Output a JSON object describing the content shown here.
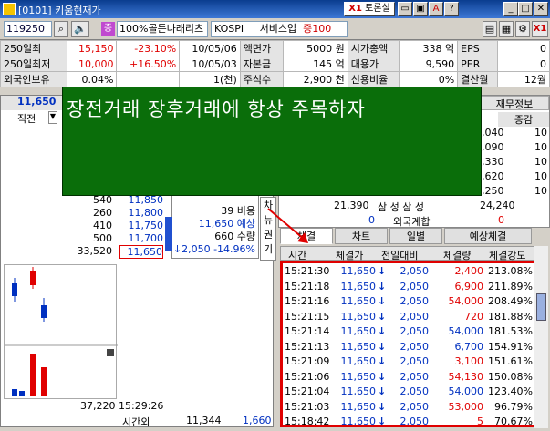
{
  "window": {
    "title": "[0101] 키움현재가",
    "x1_label": "X1",
    "toron_label": "토론실"
  },
  "toolbar": {
    "code": "119250",
    "rate_label": "100%",
    "jeung_label": "증",
    "stock_name": "골든나래리츠",
    "market": "KOSPI",
    "sector": "서비스업",
    "margin": "증100"
  },
  "info_rows": [
    [
      "250일최",
      "15,150",
      "-23.10%",
      "10/05/06",
      "액면가",
      "5000 원",
      "시가총액",
      "338 억",
      "EPS",
      "0"
    ],
    [
      "250일최저",
      "10,000",
      "+16.50%",
      "10/05/03",
      "자본금",
      "145 억",
      "대용가",
      "9,590",
      "PER",
      "0"
    ],
    [
      "외국인보유",
      "0.04%",
      "",
      "1(천)",
      "주식수",
      "2,900 천",
      "신용비율",
      "0%",
      "결산월",
      "12월"
    ]
  ],
  "banner_text": "장전거래 장후거래에 항상 주목하자",
  "right_header": {
    "tab1": "재무정보",
    "col": "증감"
  },
  "price_header": {
    "price": "11,650",
    "prev": "직전"
  },
  "right_values": [
    "1,040",
    "1,090",
    "8,330",
    "4,620",
    "1,250"
  ],
  "right_flags": [
    "10",
    "10",
    "10",
    "10",
    "10"
  ],
  "foreign_row": {
    "q": "21,390",
    "label": "삼 성 삼 성",
    "v": "24,240"
  },
  "foreign_total": {
    "v": "0",
    "label": "외국계합",
    "w": "0"
  },
  "orderbook": [
    {
      "qty": "540",
      "price": "11,850"
    },
    {
      "qty": "260",
      "price": "11,800"
    },
    {
      "qty": "410",
      "price": "11,750"
    },
    {
      "qty": "500",
      "price": "11,700"
    },
    {
      "qty": "33,520",
      "price": "11,650"
    }
  ],
  "infowin": {
    "a": "39 비용",
    "b": "11,650 예상",
    "c": "660 수량",
    "d": "2,050 -14.96%"
  },
  "side_labels": [
    "차",
    "뉴",
    "권",
    "기"
  ],
  "bottom": {
    "vol": "37,220",
    "time": "15:29:26",
    "label": "시간외",
    "q1": "11,344",
    "q2": "1,660"
  },
  "trade_tabs": [
    "체결",
    "차트",
    "일별",
    "예상체결"
  ],
  "trade_headers": [
    "시간",
    "체결가",
    "전일대비",
    "체결량",
    "체결강도"
  ],
  "trades": [
    {
      "time": "15:21:30",
      "price": "11,650",
      "diff": "2,050",
      "qty": "2,400",
      "strength": "213.08%",
      "qtyred": true
    },
    {
      "time": "15:21:18",
      "price": "11,650",
      "diff": "2,050",
      "qty": "6,900",
      "strength": "211.89%",
      "qtyred": true
    },
    {
      "time": "15:21:16",
      "price": "11,650",
      "diff": "2,050",
      "qty": "54,000",
      "strength": "208.49%",
      "qtyred": true
    },
    {
      "time": "15:21:15",
      "price": "11,650",
      "diff": "2,050",
      "qty": "720",
      "strength": "181.88%",
      "qtyred": true
    },
    {
      "time": "15:21:14",
      "price": "11,650",
      "diff": "2,050",
      "qty": "54,000",
      "strength": "181.53%",
      "qtyred": false
    },
    {
      "time": "15:21:13",
      "price": "11,650",
      "diff": "2,050",
      "qty": "6,700",
      "strength": "154.91%",
      "qtyred": false
    },
    {
      "time": "15:21:09",
      "price": "11,650",
      "diff": "2,050",
      "qty": "3,100",
      "strength": "151.61%",
      "qtyred": true
    },
    {
      "time": "15:21:06",
      "price": "11,650",
      "diff": "2,050",
      "qty": "54,130",
      "strength": "150.08%",
      "qtyred": true
    },
    {
      "time": "15:21:04",
      "price": "11,650",
      "diff": "2,050",
      "qty": "54,000",
      "strength": "123.40%",
      "qtyred": false
    },
    {
      "time": "15:21:03",
      "price": "11,650",
      "diff": "2,050",
      "qty": "53,000",
      "strength": "96.79%",
      "qtyred": true
    },
    {
      "time": "15:18:42",
      "price": "11,650",
      "diff": "2,050",
      "qty": "5",
      "strength": "70.67%",
      "qtyred": true
    }
  ],
  "colors": {
    "banner": "#0a6e0a",
    "highlight": "#e00000",
    "up": "#e00000",
    "down": "#0030c0"
  }
}
